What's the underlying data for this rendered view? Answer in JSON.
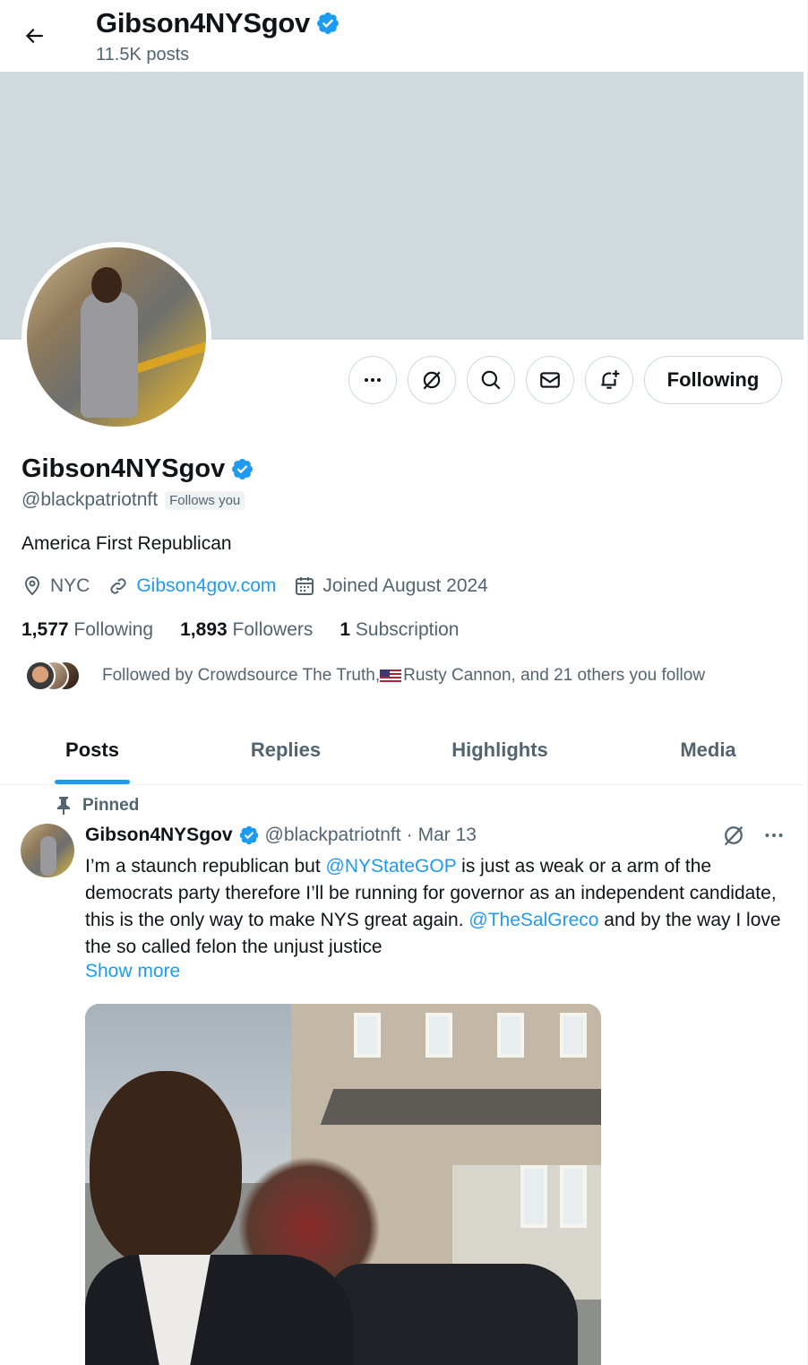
{
  "header": {
    "display_name": "Gibson4NYSgov",
    "post_count": "11.5K posts"
  },
  "profile": {
    "display_name": "Gibson4NYSgov",
    "handle": "@blackpatriotnft",
    "follows_you": "Follows you",
    "bio": "America First Republican",
    "location": "NYC",
    "website": "Gibson4gov.com",
    "joined": "Joined August 2024",
    "following_count": "1,577",
    "following_label": "Following",
    "followers_count": "1,893",
    "followers_label": "Followers",
    "subscription_count": "1",
    "subscription_label": "Subscription",
    "followed_by_prefix": "Followed by Crowdsource The Truth, ",
    "followed_by_suffix": "Rusty Cannon, and 21 others you follow",
    "follow_button": "Following"
  },
  "tabs": [
    {
      "label": "Posts"
    },
    {
      "label": "Replies"
    },
    {
      "label": "Highlights"
    },
    {
      "label": "Media"
    }
  ],
  "pinned_post": {
    "pinned_label": "Pinned",
    "author_name": "Gibson4NYSgov",
    "author_handle": "@blackpatriotnft",
    "separator": "·",
    "date": "Mar 13",
    "text_part1": "I’m a staunch republican but ",
    "mention1": "@NYStateGOP",
    "text_part2": " is just as weak or a arm of the democrats party therefore I’ll be running for governor as an independent candidate, this is the only way to make NYS great again. ",
    "mention2": "@TheSalGreco",
    "text_part3": " and by the way I love the so called felon the unjust justice",
    "show_more": "Show more"
  },
  "icons": {
    "back": "arrow-left-icon",
    "verified": "verified-badge-icon",
    "more": "more-dots-icon",
    "grok": "grok-icon",
    "search": "search-icon",
    "message": "envelope-icon",
    "notify": "bell-plus-icon",
    "location": "location-pin-icon",
    "link": "link-icon",
    "calendar": "calendar-icon",
    "pin": "pin-icon"
  },
  "colors": {
    "accent": "#1d9bf0",
    "muted": "#536471",
    "banner": "#cfd9de"
  }
}
